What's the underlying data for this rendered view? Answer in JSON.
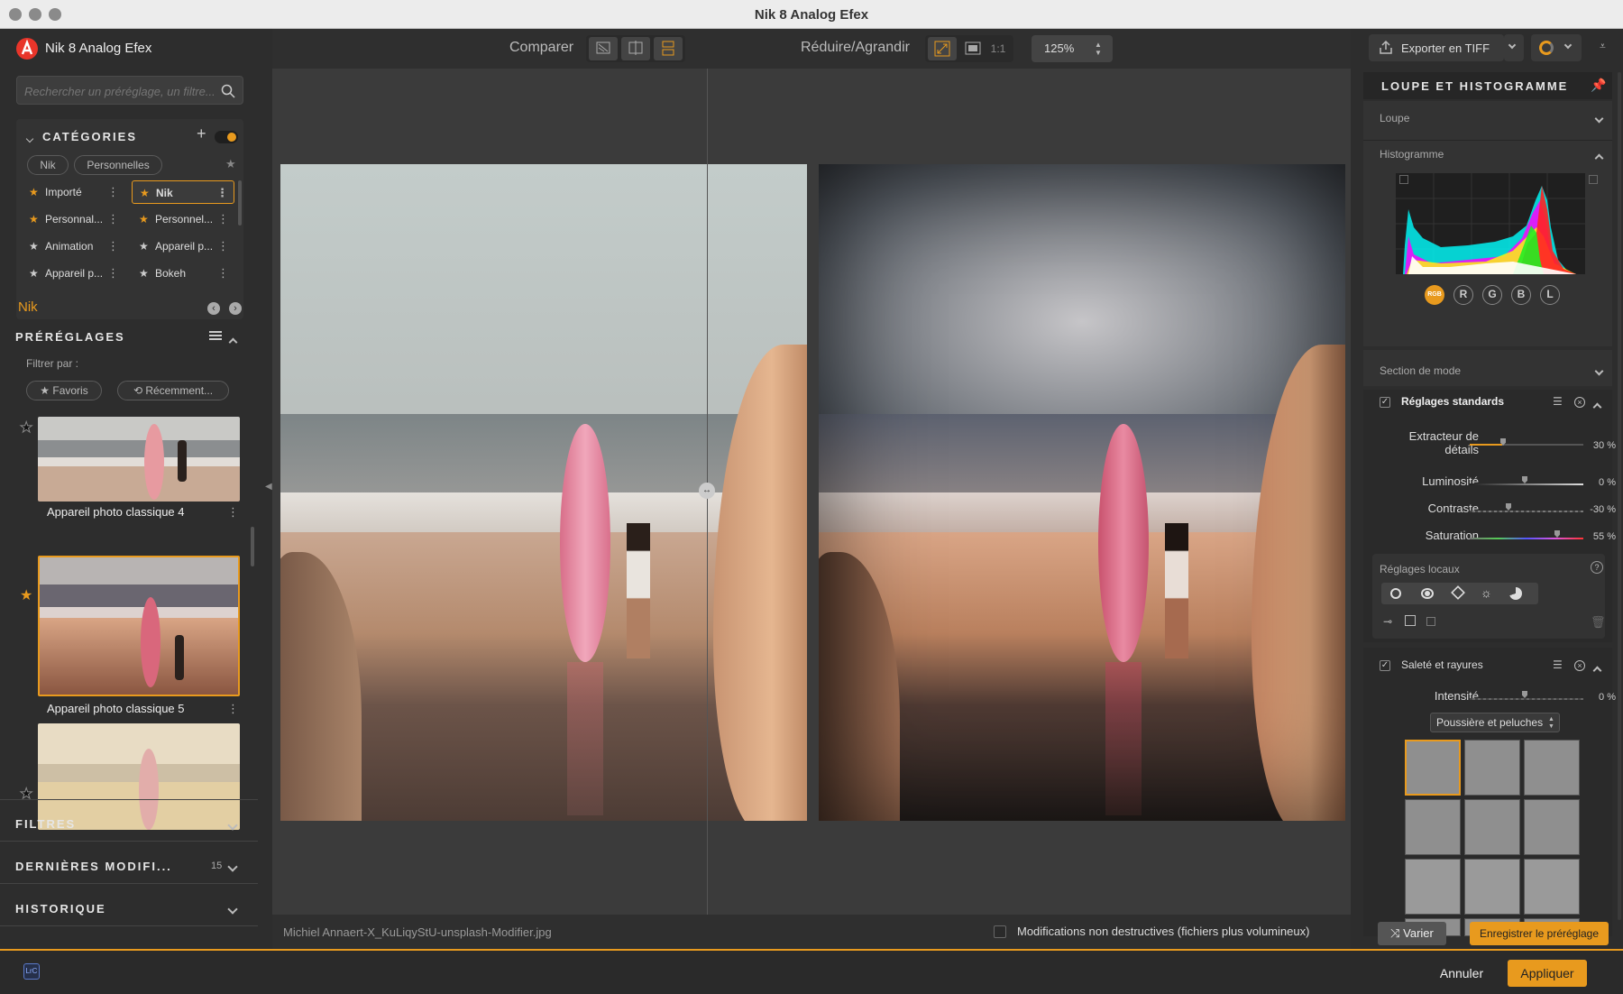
{
  "window": {
    "title": "Nik 8 Analog Efex"
  },
  "app": {
    "name": "Nik 8 Analog Efex"
  },
  "search": {
    "placeholder": "Rechercher un préréglage, un filtre..."
  },
  "categories": {
    "title": "CATÉGORIES",
    "chips": [
      "Nik",
      "Personnelles"
    ],
    "items": [
      {
        "label": "Importé",
        "selected": false
      },
      {
        "label": "Nik",
        "selected": true
      },
      {
        "label": "Personnal...",
        "selected": false
      },
      {
        "label": "Personnel...",
        "selected": false
      },
      {
        "label": "Animation",
        "selected": false
      },
      {
        "label": "Appareil p...",
        "selected": false
      },
      {
        "label": "Appareil p...",
        "selected": false
      },
      {
        "label": "Bokeh",
        "selected": false
      }
    ],
    "current": "Nik"
  },
  "presets": {
    "title": "PRÉRÉGLAGES",
    "filter_label": "Filtrer par :",
    "filter_chips": [
      "★ Favoris",
      "⟲ Récemment..."
    ],
    "items": [
      {
        "label": "Appareil photo classique 4",
        "favorite": false,
        "selected": false
      },
      {
        "label": "Appareil photo classique 5",
        "favorite": true,
        "selected": true
      }
    ]
  },
  "sections": {
    "filters": "FILTRES",
    "recent": "DERNIÈRES MODIFI...",
    "recent_count": "15",
    "history": "HISTORIQUE"
  },
  "toolbar": {
    "compare_label": "Comparer",
    "zoom_label": "Réduire/Agrandir",
    "ratio_label": "1:1",
    "zoom_value": "125%"
  },
  "status": {
    "filename": "Michiel Annaert-X_KuLiqyStU-unsplash-Modifier.jpg",
    "non_destructive_label": "Modifications non destructives (fichiers plus volumineux)"
  },
  "export": {
    "label": "Exporter en TIFF"
  },
  "loupe_panel": {
    "title": "LOUPE ET HISTOGRAMME",
    "loupe_label": "Loupe",
    "histogram_label": "Histogramme",
    "channels": [
      "RGB",
      "R",
      "G",
      "B",
      "L"
    ],
    "mode_section": "Section de mode"
  },
  "standard": {
    "title": "Réglages standards",
    "sliders": [
      {
        "label": "Extracteur de détails",
        "value_text": "30 %",
        "value": 30
      },
      {
        "label": "Luminosité",
        "value_text": "0 %",
        "value": 0
      },
      {
        "label": "Contraste",
        "value_text": "-30 %",
        "value": -30
      },
      {
        "label": "Saturation",
        "value_text": "55 %",
        "value": 55
      }
    ],
    "local_label": "Réglages locaux"
  },
  "dirt": {
    "title": "Saleté et rayures",
    "intensity_label": "Intensité",
    "intensity_value": "0 %",
    "select_value": "Poussière et peluches"
  },
  "footer": {
    "vary_label": "Varier",
    "save_preset_label": "Enregistrer le préréglage",
    "lrc_badge": "LrC",
    "cancel_label": "Annuler",
    "apply_label": "Appliquer"
  },
  "colors": {
    "accent": "#e89a1e",
    "panel": "#2d2d2d",
    "canvas": "#3b3b3b"
  }
}
